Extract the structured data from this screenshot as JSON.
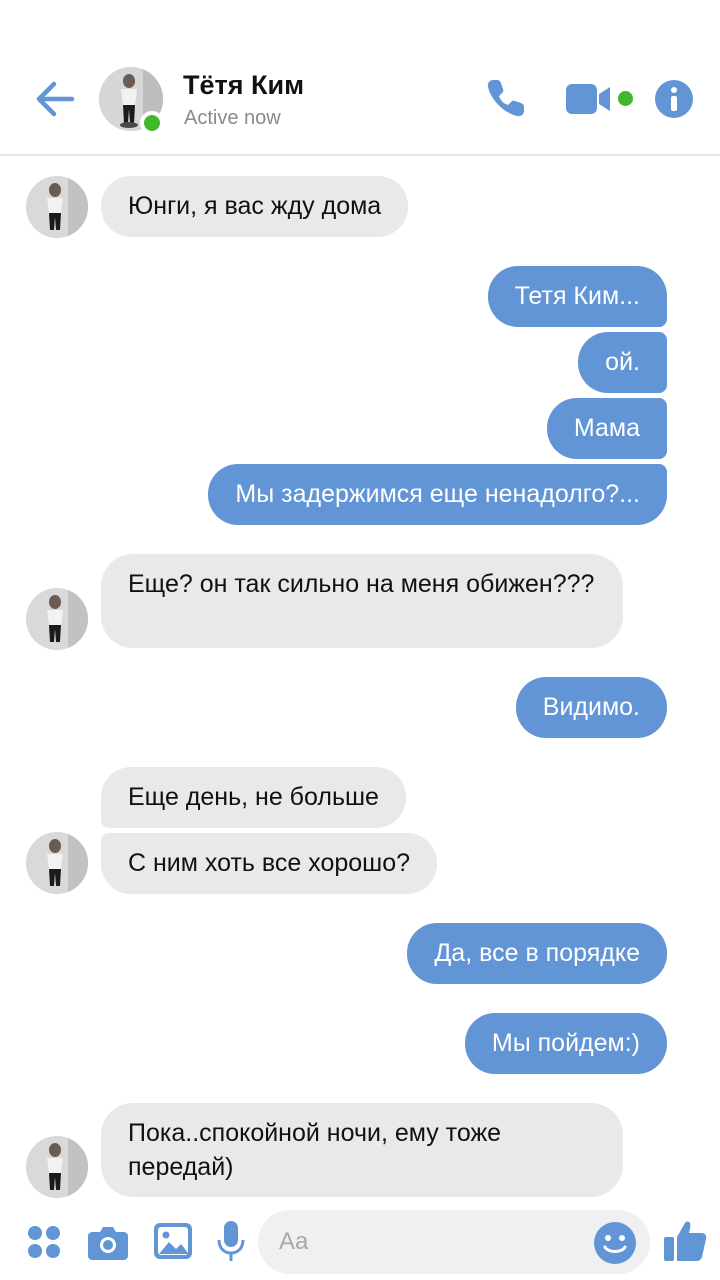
{
  "header": {
    "contact_name": "Тётя Ким",
    "status": "Active now"
  },
  "messages": [
    {
      "side": "in",
      "text": "Юнги, я вас жду дома"
    },
    {
      "side": "out",
      "text": "Тетя Ким..."
    },
    {
      "side": "out",
      "text": "ой."
    },
    {
      "side": "out",
      "text": "Мама"
    },
    {
      "side": "out",
      "text": "Мы задержимся еще ненадолго?..."
    },
    {
      "side": "in",
      "text": "Еще? он так сильно на меня обижен???"
    },
    {
      "side": "out",
      "text": "Видимо."
    },
    {
      "side": "in",
      "text": "Еще день, не больше"
    },
    {
      "side": "in",
      "text": "С ним хоть все хорошо?"
    },
    {
      "side": "out",
      "text": "Да, все в порядке"
    },
    {
      "side": "out",
      "text": "Мы пойдем:)"
    },
    {
      "side": "in",
      "text": "Пока..спокойной ночи, ему тоже передай)"
    }
  ],
  "composer": {
    "placeholder": "Aa"
  },
  "colors": {
    "accent": "#6195d5",
    "incoming_bubble": "#e9e9eb",
    "online": "#42b72a"
  },
  "icons": [
    "back-arrow-icon",
    "phone-icon",
    "video-camera-icon",
    "info-icon",
    "apps-icon",
    "camera-icon",
    "gallery-icon",
    "microphone-icon",
    "emoji-icon",
    "thumbs-up-icon"
  ]
}
